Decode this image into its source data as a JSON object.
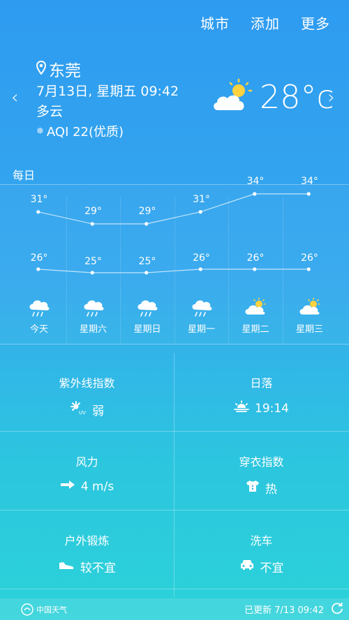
{
  "nav": {
    "city": "城市",
    "add": "添加",
    "more": "更多"
  },
  "current": {
    "city": "东莞",
    "datetime": "7月13日, 星期五 09:42",
    "condition": "多云",
    "aqi": "AQI 22(优质)",
    "temp": "28°c"
  },
  "section_label": "每日",
  "chart_data": {
    "type": "line",
    "categories": [
      "今天",
      "星期六",
      "星期日",
      "星期一",
      "星期二",
      "星期三"
    ],
    "series": [
      {
        "values": [
          31,
          29,
          29,
          31,
          34,
          34
        ]
      },
      {
        "values": [
          26,
          25,
          25,
          26,
          26,
          26
        ]
      }
    ],
    "hi_labels": [
      "31°",
      "29°",
      "29°",
      "31°",
      "34°",
      "34°"
    ],
    "lo_labels": [
      "26°",
      "25°",
      "25°",
      "26°",
      "26°",
      "26°"
    ],
    "icons": [
      "rain-cloud-icon",
      "rain-cloud-icon",
      "rain-cloud-icon",
      "rain-cloud-icon",
      "partly-cloudy-icon",
      "partly-cloudy-icon"
    ]
  },
  "grid": [
    {
      "title": "紫外线指数",
      "value": "弱",
      "icon": "uv-icon"
    },
    {
      "title": "日落",
      "value": "19:14",
      "icon": "sunset-icon"
    },
    {
      "title": "风力",
      "value": "4 m/s",
      "icon": "wind-arrow-icon"
    },
    {
      "title": "穿衣指数",
      "value": "热",
      "icon": "shirt-icon"
    },
    {
      "title": "户外锻炼",
      "value": "较不宜",
      "icon": "shoe-icon"
    },
    {
      "title": "洗车",
      "value": "不宜",
      "icon": "car-icon"
    }
  ],
  "footer": {
    "brand": "中国天气",
    "updated": "已更新 7/13  09:42"
  }
}
